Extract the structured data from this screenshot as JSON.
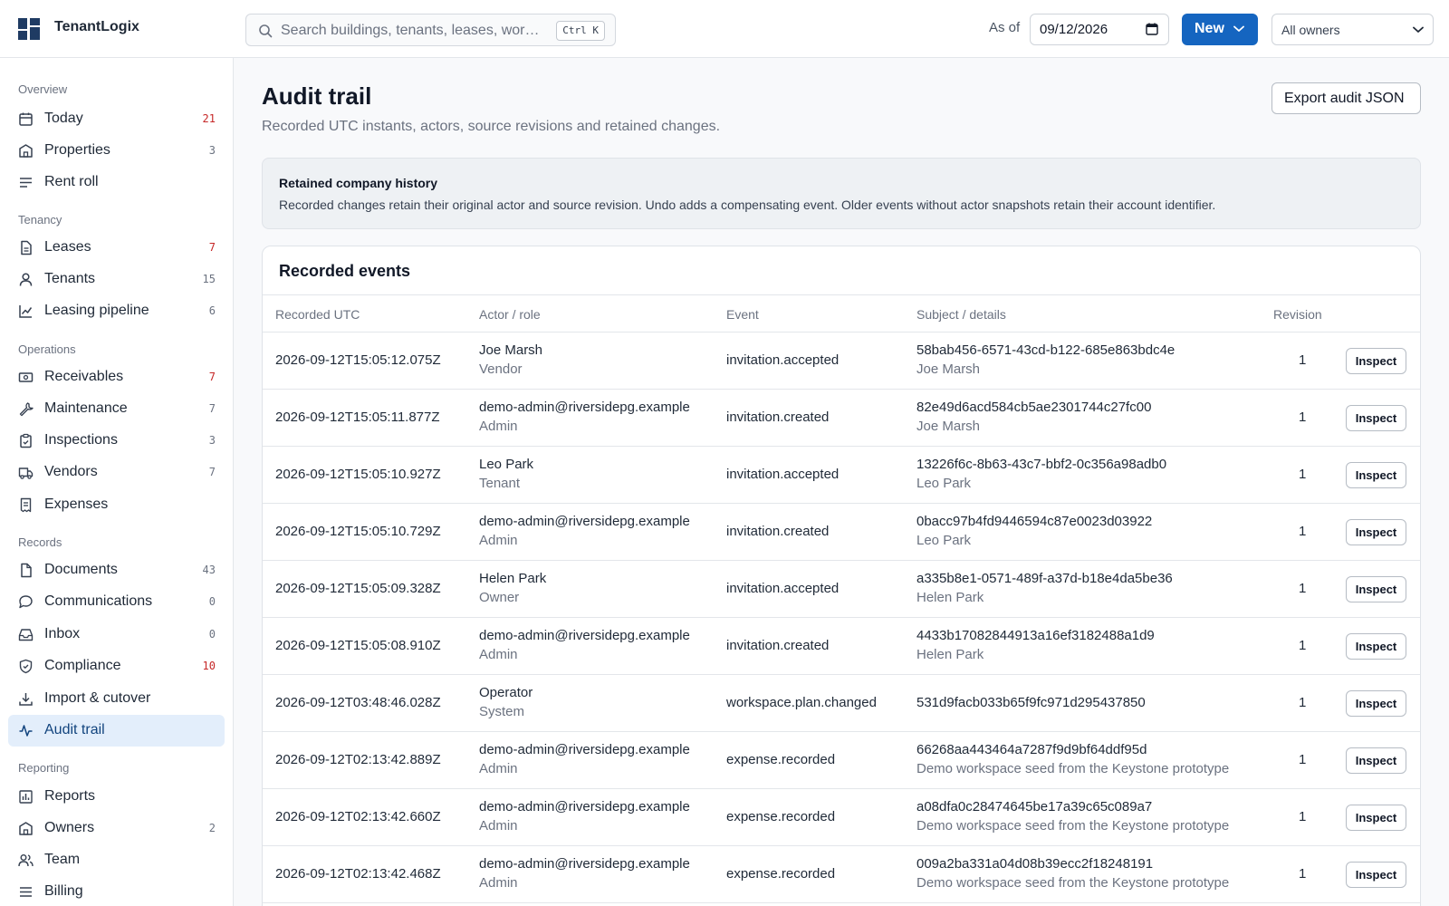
{
  "app": {
    "name": "TenantLogix"
  },
  "header": {
    "search_placeholder": "Search buildings, tenants, leases, wor…",
    "search_shortcut": "Ctrl K",
    "as_of_label": "As of",
    "as_of_date": "09/12/2026",
    "new_label": "New",
    "owner_filter": "All owners"
  },
  "sidebar": {
    "groups": [
      {
        "label": "Overview",
        "items": [
          {
            "label": "Today",
            "count": "21",
            "alert": true,
            "icon": "calendar-icon"
          },
          {
            "label": "Properties",
            "count": "3",
            "alert": false,
            "icon": "building-icon"
          },
          {
            "label": "Rent roll",
            "count": "",
            "alert": false,
            "icon": "list-icon"
          }
        ]
      },
      {
        "label": "Tenancy",
        "items": [
          {
            "label": "Leases",
            "count": "7",
            "alert": true,
            "icon": "file-icon"
          },
          {
            "label": "Tenants",
            "count": "15",
            "alert": false,
            "icon": "user-icon"
          },
          {
            "label": "Leasing pipeline",
            "count": "6",
            "alert": false,
            "icon": "chart-icon"
          }
        ]
      },
      {
        "label": "Operations",
        "items": [
          {
            "label": "Receivables",
            "count": "7",
            "alert": true,
            "icon": "cash-icon"
          },
          {
            "label": "Maintenance",
            "count": "7",
            "alert": false,
            "icon": "wrench-icon"
          },
          {
            "label": "Inspections",
            "count": "3",
            "alert": false,
            "icon": "clipboard-icon"
          },
          {
            "label": "Vendors",
            "count": "7",
            "alert": false,
            "icon": "truck-icon"
          },
          {
            "label": "Expenses",
            "count": "",
            "alert": false,
            "icon": "receipt-icon"
          }
        ]
      },
      {
        "label": "Records",
        "items": [
          {
            "label": "Documents",
            "count": "43",
            "alert": false,
            "icon": "document-icon"
          },
          {
            "label": "Communications",
            "count": "0",
            "alert": false,
            "icon": "chat-icon"
          },
          {
            "label": "Inbox",
            "count": "0",
            "alert": false,
            "icon": "inbox-icon"
          },
          {
            "label": "Compliance",
            "count": "10",
            "alert": true,
            "icon": "shield-icon"
          },
          {
            "label": "Import & cutover",
            "count": "",
            "alert": false,
            "icon": "download-icon"
          },
          {
            "label": "Audit trail",
            "count": "",
            "alert": false,
            "active": true,
            "icon": "activity-icon"
          }
        ]
      },
      {
        "label": "Reporting",
        "items": [
          {
            "label": "Reports",
            "count": "",
            "alert": false,
            "icon": "report-icon"
          },
          {
            "label": "Owners",
            "count": "2",
            "alert": false,
            "icon": "building-icon"
          },
          {
            "label": "Team",
            "count": "",
            "alert": false,
            "icon": "users-icon"
          },
          {
            "label": "Billing",
            "count": "",
            "alert": false,
            "icon": "list-icon"
          }
        ]
      }
    ]
  },
  "page": {
    "title": "Audit trail",
    "subtitle": "Recorded UTC instants, actors, source revisions and retained changes.",
    "export_label": "Export audit JSON"
  },
  "notice": {
    "title": "Retained company history",
    "body": "Recorded changes retain their original actor and source revision. Undo adds a compensating event. Older events without actor snapshots retain their account identifier."
  },
  "events": {
    "title": "Recorded events",
    "columns": [
      "Recorded UTC",
      "Actor / role",
      "Event",
      "Subject / details",
      "Revision"
    ],
    "inspect_label": "Inspect",
    "rows": [
      {
        "time": "2026-09-12T15:05:12.075Z",
        "actor": "Joe Marsh",
        "role": "Vendor",
        "event": "invitation.accepted",
        "subject": "58bab456-6571-43cd-b122-685e863bdc4e",
        "detail": "Joe Marsh",
        "revision": "1"
      },
      {
        "time": "2026-09-12T15:05:11.877Z",
        "actor": "demo-admin@riversidepg.example",
        "role": "Admin",
        "event": "invitation.created",
        "subject": "82e49d6acd584cb5ae2301744c27fc00",
        "detail": "Joe Marsh",
        "revision": "1"
      },
      {
        "time": "2026-09-12T15:05:10.927Z",
        "actor": "Leo Park",
        "role": "Tenant",
        "event": "invitation.accepted",
        "subject": "13226f6c-8b63-43c7-bbf2-0c356a98adb0",
        "detail": "Leo Park",
        "revision": "1"
      },
      {
        "time": "2026-09-12T15:05:10.729Z",
        "actor": "demo-admin@riversidepg.example",
        "role": "Admin",
        "event": "invitation.created",
        "subject": "0bacc97b4fd9446594c87e0023d03922",
        "detail": "Leo Park",
        "revision": "1"
      },
      {
        "time": "2026-09-12T15:05:09.328Z",
        "actor": "Helen Park",
        "role": "Owner",
        "event": "invitation.accepted",
        "subject": "a335b8e1-0571-489f-a37d-b18e4da5be36",
        "detail": "Helen Park",
        "revision": "1"
      },
      {
        "time": "2026-09-12T15:05:08.910Z",
        "actor": "demo-admin@riversidepg.example",
        "role": "Admin",
        "event": "invitation.created",
        "subject": "4433b17082844913a16ef3182488a1d9",
        "detail": "Helen Park",
        "revision": "1"
      },
      {
        "time": "2026-09-12T03:48:46.028Z",
        "actor": "Operator",
        "role": "System",
        "event": "workspace.plan.changed",
        "subject": "531d9facb033b65f9fc971d295437850",
        "detail": "",
        "revision": "1"
      },
      {
        "time": "2026-09-12T02:13:42.889Z",
        "actor": "demo-admin@riversidepg.example",
        "role": "Admin",
        "event": "expense.recorded",
        "subject": "66268aa443464a7287f9d9bf64ddf95d",
        "detail": "Demo workspace seed from the Keystone prototype",
        "revision": "1"
      },
      {
        "time": "2026-09-12T02:13:42.660Z",
        "actor": "demo-admin@riversidepg.example",
        "role": "Admin",
        "event": "expense.recorded",
        "subject": "a08dfa0c28474645be17a39c65c089a7",
        "detail": "Demo workspace seed from the Keystone prototype",
        "revision": "1"
      },
      {
        "time": "2026-09-12T02:13:42.468Z",
        "actor": "demo-admin@riversidepg.example",
        "role": "Admin",
        "event": "expense.recorded",
        "subject": "009a2ba331a04d08b39ecc2f18248191",
        "detail": "Demo workspace seed from the Keystone prototype",
        "revision": "1"
      }
    ]
  },
  "colors": {
    "accent": "#1565c0",
    "active_bg": "#e3eefb",
    "alert": "#c62828",
    "brand": "#1f3b63"
  }
}
